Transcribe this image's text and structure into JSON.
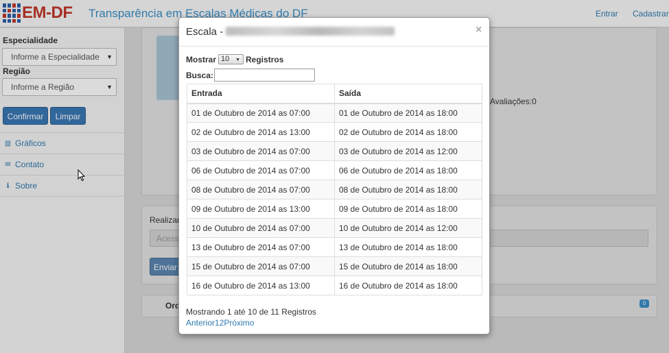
{
  "navbar": {
    "logo_text": "EM-DF",
    "title": "Transparência em Escalas Médicas do DF",
    "login_label": "Entrar",
    "register_label": "Cadastrar"
  },
  "sidebar": {
    "specialty_label": "Especialidade",
    "specialty_value": "Informe a Especialidade",
    "region_label": "Região",
    "region_value": "Informe a Região",
    "confirm_label": "Confirmar",
    "clear_label": "Limpar",
    "links": [
      {
        "label": "Gráficos",
        "icon": "bar-chart-icon"
      },
      {
        "label": "Contato",
        "icon": "envelope-icon"
      },
      {
        "label": "Sobre",
        "icon": "info-icon"
      }
    ]
  },
  "background": {
    "evaluations_text": "Avaliações:0",
    "realizar_text": "Realizar",
    "access_placeholder": "Acesse",
    "send_label": "Enviar",
    "order_text": "Ord",
    "badge_count": "0"
  },
  "modal": {
    "title": "Escala -",
    "close_label": "×",
    "show_label": "Mostrar",
    "show_value": "10",
    "records_label": "Registros",
    "search_label": "Busca:",
    "columns": [
      "Entrada",
      "Saída"
    ],
    "rows": [
      [
        "01 de Outubro de 2014 as 07:00",
        "01 de Outubro de 2014 as 18:00"
      ],
      [
        "02 de Outubro de 2014 as 13:00",
        "02 de Outubro de 2014 as 18:00"
      ],
      [
        "03 de Outubro de 2014 as 07:00",
        "03 de Outubro de 2014 as 12:00"
      ],
      [
        "06 de Outubro de 2014 as 07:00",
        "06 de Outubro de 2014 as 18:00"
      ],
      [
        "08 de Outubro de 2014 as 07:00",
        "08 de Outubro de 2014 as 18:00"
      ],
      [
        "09 de Outubro de 2014 as 13:00",
        "09 de Outubro de 2014 as 18:00"
      ],
      [
        "10 de Outubro de 2014 as 07:00",
        "10 de Outubro de 2014 as 12:00"
      ],
      [
        "13 de Outubro de 2014 as 07:00",
        "13 de Outubro de 2014 as 18:00"
      ],
      [
        "15 de Outubro de 2014 as 07:00",
        "15 de Outubro de 2014 as 18:00"
      ],
      [
        "16 de Outubro de 2014 as 13:00",
        "16 de Outubro de 2014 as 18:00"
      ]
    ],
    "info_text": "Mostrando 1 até 10 de 11 Registros",
    "pager": {
      "previous": "Anterior",
      "pages": [
        "1",
        "2"
      ],
      "next": "Próximo"
    }
  },
  "colors": {
    "brand_red": "#c0392b",
    "brand_blue": "#2c5fa8",
    "link": "#2f7ab0",
    "button": "#3a78b5"
  }
}
